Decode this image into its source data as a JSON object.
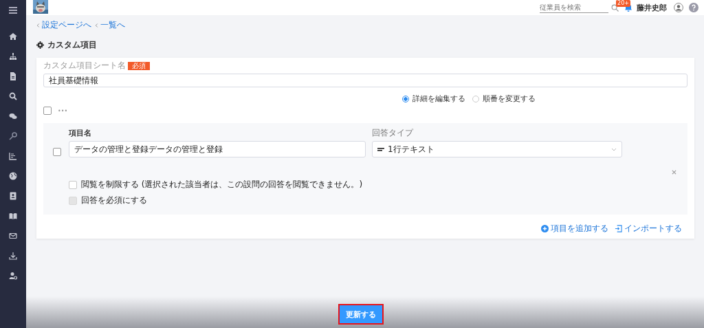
{
  "header": {
    "search": {
      "placeholder": "従業員を検索"
    },
    "notification_count": "20+",
    "user_name": "藤井史郎"
  },
  "breadcrumbs": [
    {
      "label": "設定ページへ"
    },
    {
      "label": "一覧へ"
    }
  ],
  "page_title": "カスタム項目",
  "sheet_name": {
    "label": "カスタム項目シート名",
    "required_badge": "必須",
    "value": "社員基礎情報"
  },
  "mode_options": [
    {
      "label": "詳細を編集する",
      "selected": true
    },
    {
      "label": "順番を変更する",
      "selected": false
    }
  ],
  "select_all": {
    "checked": false,
    "more": "•••"
  },
  "items": [
    {
      "checked": false,
      "name_label": "項目名",
      "name": "データの管理と登録データの管理と登録",
      "type_label": "回答タイプ",
      "type": "1行テキスト",
      "options": [
        {
          "label": "閲覧を制限する (選択された該当者は、この設問の回答を閲覧できません。)",
          "checked": false,
          "disabled": false
        },
        {
          "label": "回答を必須にする",
          "checked": false,
          "disabled": true
        }
      ]
    }
  ],
  "actions": [
    {
      "label": "項目を追加する",
      "kind": "add"
    },
    {
      "label": "インポートする",
      "kind": "import"
    }
  ],
  "submit": "更新する"
}
